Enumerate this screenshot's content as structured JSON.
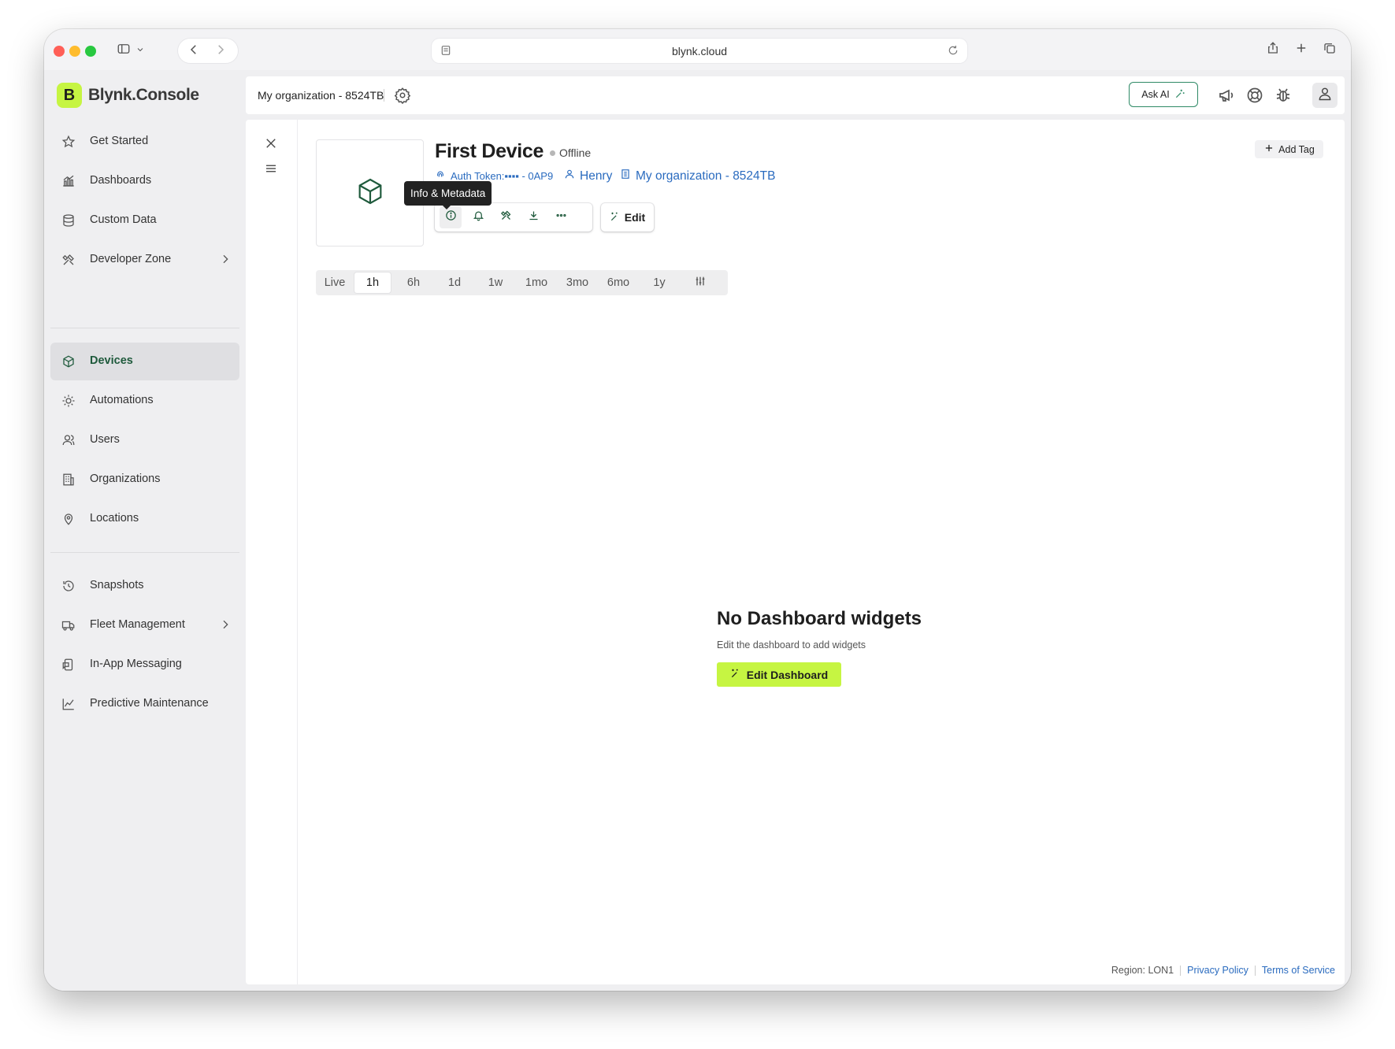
{
  "browser": {
    "url": "blynk.cloud"
  },
  "brand": {
    "logo_letter": "B",
    "name": "Blynk.Console",
    "accent": "#c6f542"
  },
  "sidebar": {
    "items": [
      {
        "label": "Get Started",
        "icon": "star-icon"
      },
      {
        "label": "Dashboards",
        "icon": "chart-icon"
      },
      {
        "label": "Custom Data",
        "icon": "database-icon"
      },
      {
        "label": "Developer Zone",
        "icon": "tools-icon"
      },
      {
        "label": "Devices",
        "icon": "cube-icon",
        "active": true
      },
      {
        "label": "Automations",
        "icon": "automation-icon"
      },
      {
        "label": "Users",
        "icon": "users-icon"
      },
      {
        "label": "Organizations",
        "icon": "building-icon"
      },
      {
        "label": "Locations",
        "icon": "pin-icon"
      },
      {
        "label": "Snapshots",
        "icon": "snapshot-icon"
      },
      {
        "label": "Fleet Management",
        "icon": "truck-icon"
      },
      {
        "label": "In-App Messaging",
        "icon": "message-icon"
      },
      {
        "label": "Predictive Maintenance",
        "icon": "trend-icon"
      }
    ]
  },
  "topbar": {
    "organization": "My organization - 8524TB",
    "ask_ai": "Ask AI"
  },
  "device": {
    "name": "First Device",
    "status": "Offline",
    "auth_token": "Auth Token:▪▪▪▪ - 0AP9",
    "owner": "Henry",
    "organization": "My organization - 8524TB",
    "tooltip": "Info & Metadata",
    "edit_label": "Edit",
    "add_tag_label": "Add Tag"
  },
  "time_ranges": {
    "options": [
      "Live",
      "1h",
      "6h",
      "1d",
      "1w",
      "1mo",
      "3mo",
      "6mo",
      "1y"
    ],
    "selected": "1h"
  },
  "empty_state": {
    "title": "No Dashboard widgets",
    "subtitle": "Edit the dashboard to add widgets",
    "button": "Edit Dashboard"
  },
  "footer": {
    "region": "Region: LON1",
    "privacy": "Privacy Policy",
    "terms": "Terms of Service"
  }
}
